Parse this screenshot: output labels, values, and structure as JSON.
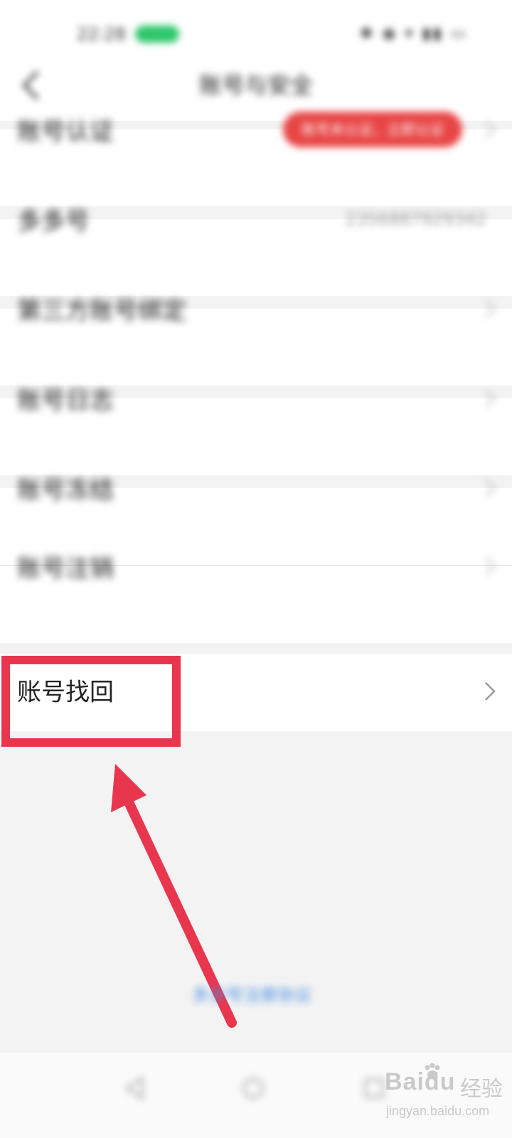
{
  "status_bar": {
    "time": "22:28",
    "icons": "✱ ◉ ▾ ▮▮ ▭"
  },
  "header": {
    "title": "账号与安全"
  },
  "rows": [
    {
      "id": "verification",
      "label": "账号认证",
      "badge": "账号未认证，立即认证"
    },
    {
      "id": "account-id",
      "label": "多多号",
      "value": "2356887929342"
    },
    {
      "id": "third-party",
      "label": "第三方账号绑定"
    },
    {
      "id": "login-records",
      "label": "账号日志"
    },
    {
      "id": "account-freeze",
      "label": "账号冻结"
    },
    {
      "id": "account-cancel",
      "label": "账号注销"
    },
    {
      "id": "account-recovery",
      "label": "账号找回"
    }
  ],
  "footer": {
    "link": "多多号注册协议"
  },
  "watermark": {
    "brand": "Bai",
    "brand_tail": "du",
    "suffix": "经验",
    "url": "jingyan.baidu.com"
  },
  "colors": {
    "highlight": "#e8364e",
    "badge": "#e84545",
    "link": "#4a90e2"
  }
}
